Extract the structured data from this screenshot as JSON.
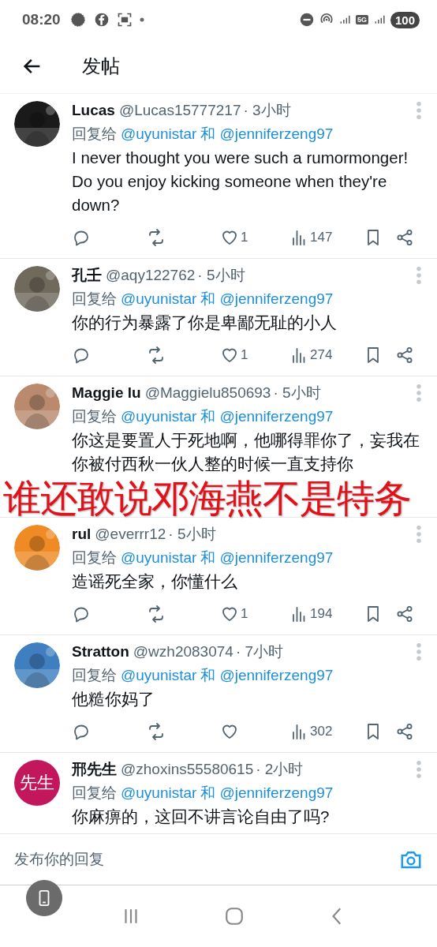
{
  "status_bar": {
    "time": "08:20",
    "network": "5G",
    "battery": "100"
  },
  "header": {
    "title": "发帖"
  },
  "replies": [
    {
      "name": "Lucas",
      "handle": "@Lucas15777217",
      "time": "· 3小时",
      "reply_prefix": "回复给",
      "reply_to": [
        "@uyunistar",
        "@jenniferzeng97"
      ],
      "reply_joiner": "和",
      "text": "I never thought you were such a rumormonger! Do you enjoy kicking someone when they're down?",
      "likes": "1",
      "views": "147"
    },
    {
      "name": "孔壬",
      "handle": "@aqy122762",
      "time": "· 5小时",
      "reply_prefix": "回复给",
      "reply_to": [
        "@uyunistar",
        "@jenniferzeng97"
      ],
      "reply_joiner": "和",
      "text": "你的行为暴露了你是卑鄙无耻的小人",
      "likes": "1",
      "views": "274"
    },
    {
      "name": "Maggie lu",
      "handle": "@Maggielu850693",
      "time": "· 5小时",
      "reply_prefix": "回复给",
      "reply_to": [
        "@uyunistar",
        "@jenniferzeng97"
      ],
      "reply_joiner": "和",
      "text": "你这是要置人于死地啊，他哪得罪你了，妄我在你被付西秋一伙人整的时候一直支持你"
    },
    {
      "name": "rul",
      "handle": "@everrr12",
      "time": "· 5小时",
      "reply_prefix": "回复给",
      "reply_to": [
        "@uyunistar",
        "@jenniferzeng97"
      ],
      "reply_joiner": "和",
      "text": "造谣死全家，你懂什么",
      "likes": "1",
      "views": "194"
    },
    {
      "name": "Stratton",
      "handle": "@wzh2083074",
      "time": "· 7小时",
      "reply_prefix": "回复给",
      "reply_to": [
        "@uyunistar",
        "@jenniferzeng97"
      ],
      "reply_joiner": "和",
      "text": "他糙你妈了",
      "views": "302"
    },
    {
      "name": "邢先生",
      "handle": "@zhoxins55580615",
      "time": "· 2小时",
      "avatar": {
        "kind": "text",
        "label": "先生",
        "color": "#c2185b"
      },
      "reply_prefix": "回复给",
      "reply_to": [
        "@uyunistar",
        "@jenniferzeng97"
      ],
      "reply_joiner": "和",
      "text": "你麻痹的，这回不讲言论自由了吗?"
    }
  ],
  "overlay_caption": "谁还敢说邓海燕不是特务",
  "reply_box": {
    "placeholder": "发布你的回复"
  }
}
